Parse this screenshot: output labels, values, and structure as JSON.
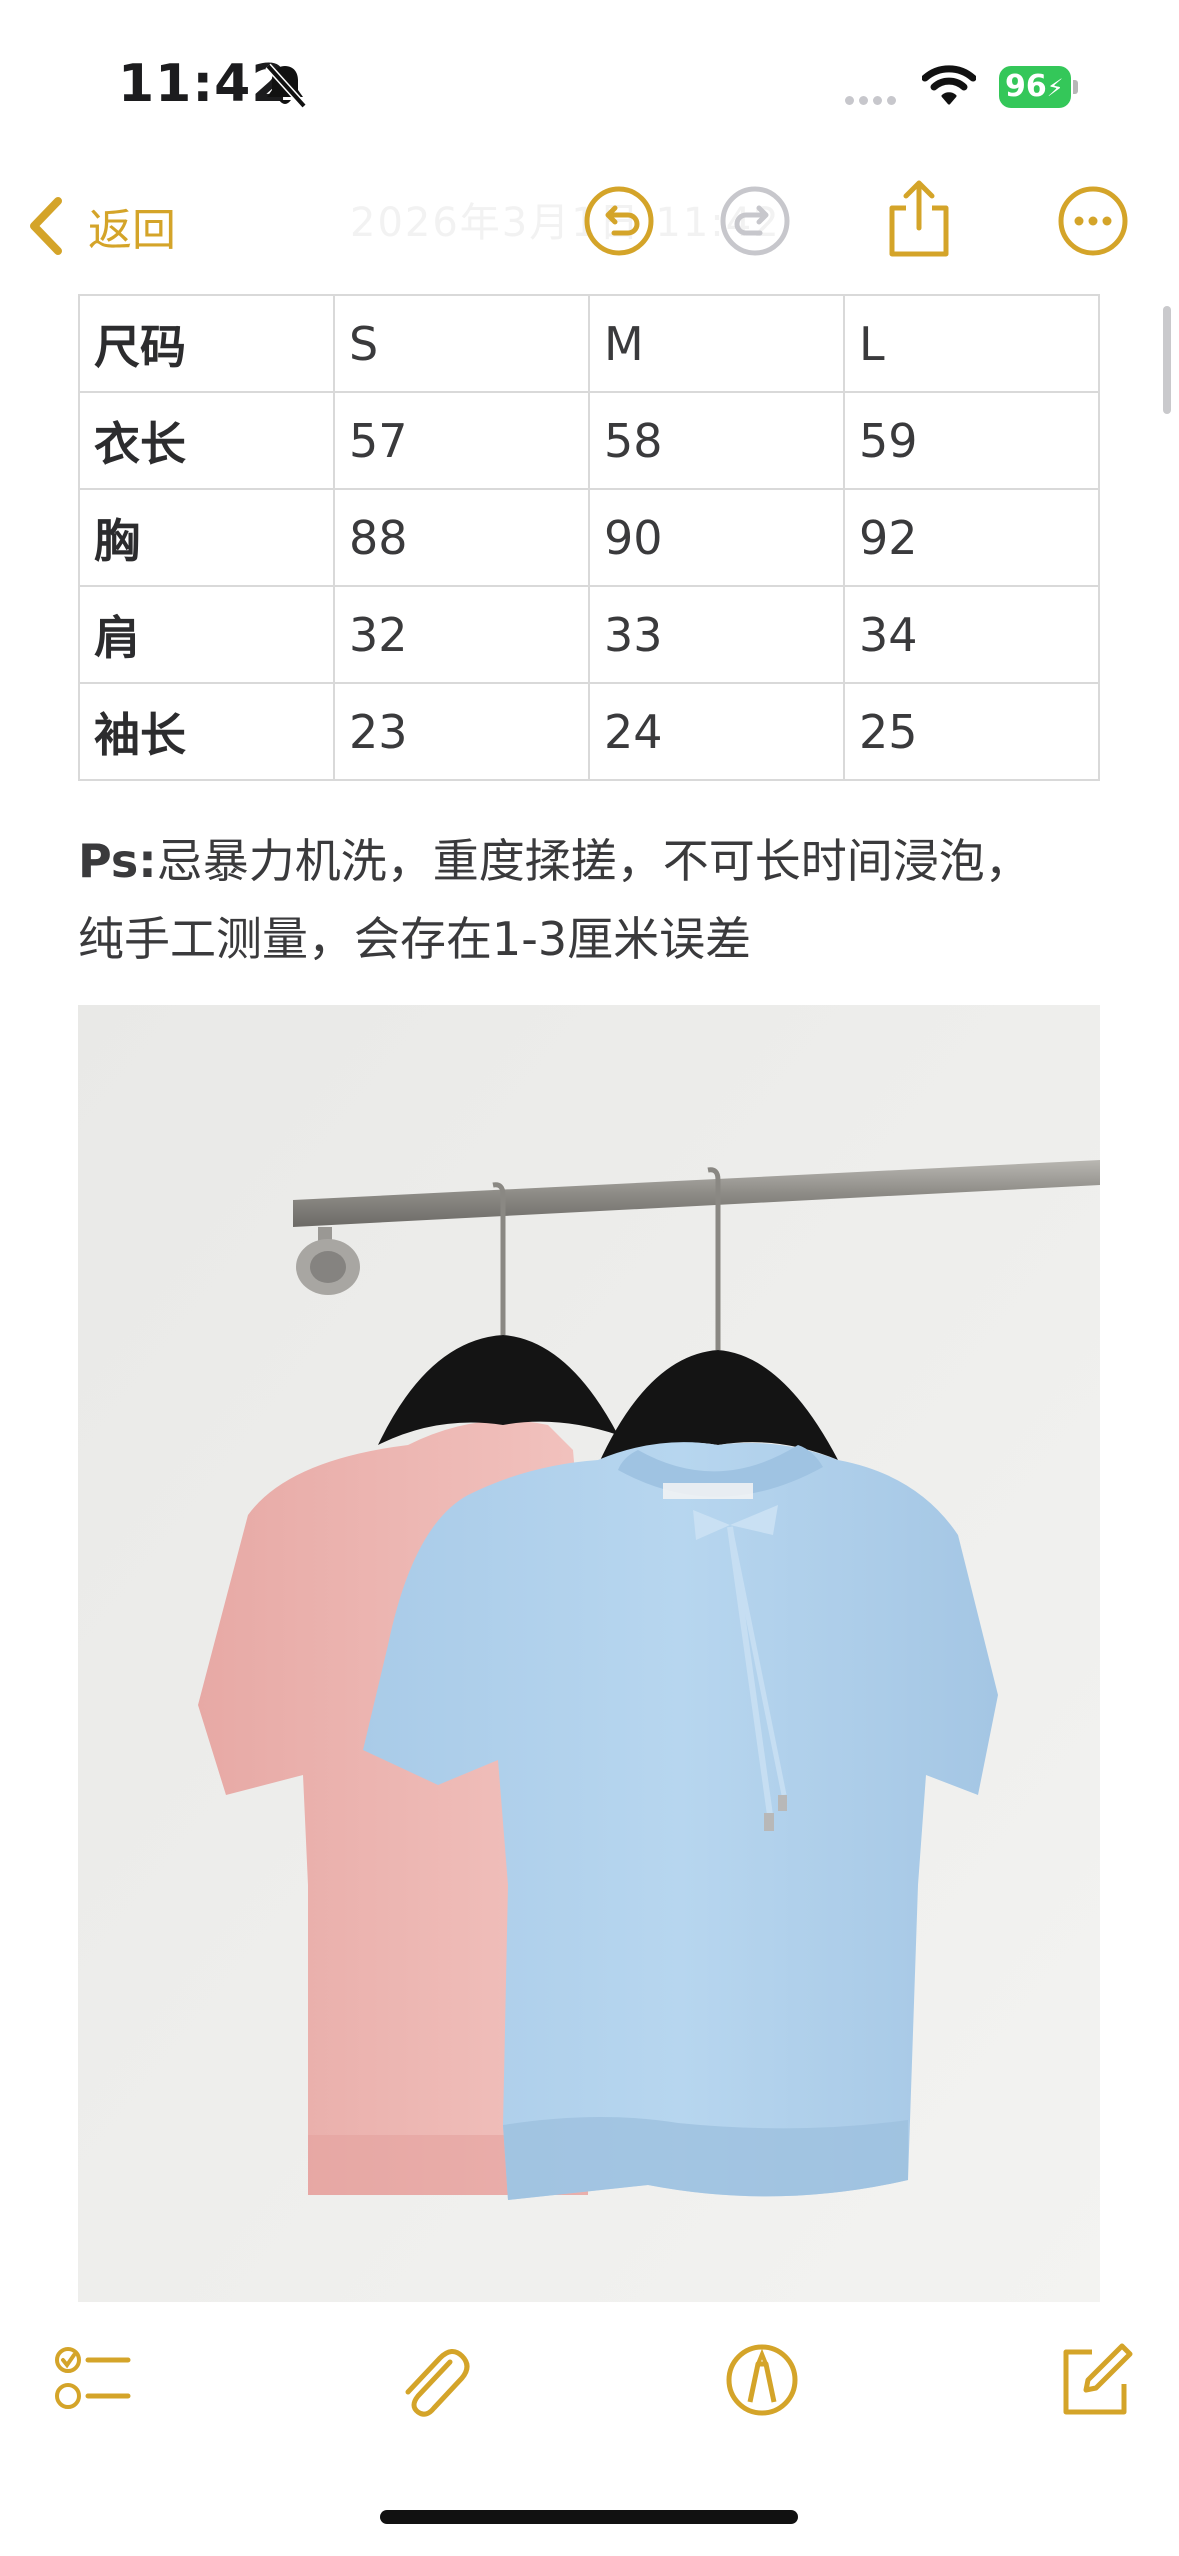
{
  "status_bar": {
    "time": "11:42",
    "battery": "96"
  },
  "nav": {
    "back_label": "返回",
    "faint_title": "2026年3月1日 11:42"
  },
  "table": {
    "rows": [
      [
        "尺码",
        "S",
        "M",
        "L"
      ],
      [
        "衣长",
        "57",
        "58",
        "59"
      ],
      [
        "胸",
        "88",
        "90",
        "92"
      ],
      [
        "肩",
        "32",
        "33",
        "34"
      ],
      [
        "袖长",
        "23",
        "24",
        "25"
      ]
    ]
  },
  "note": {
    "prefix": "Ps:",
    "line1": "忌暴力机洗，重度揉搓，不可长时间浸泡，",
    "line2": "纯手工测量，会存在1-3厘米误差"
  },
  "photo": {
    "subject": "two short-sleeve knit tops, pink and light blue, on hangers"
  },
  "colors": {
    "accent": "#d4a429",
    "table_border": "#d9d9d9",
    "battery": "#34c759"
  },
  "icons": [
    "bell-slash-icon",
    "wifi-icon",
    "undo-icon",
    "redo-icon",
    "share-icon",
    "more-icon",
    "checklist-icon",
    "attachment-icon",
    "markup-icon",
    "compose-icon"
  ]
}
